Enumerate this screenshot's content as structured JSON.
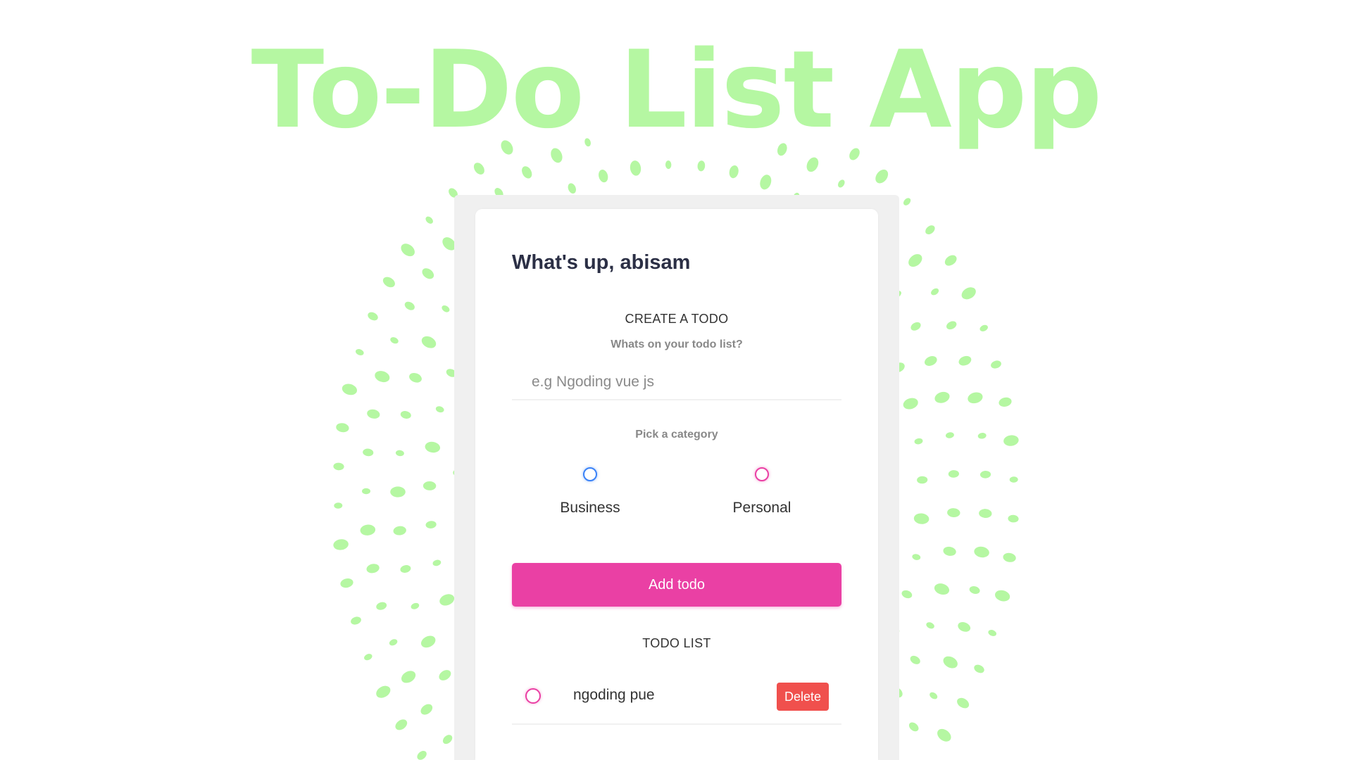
{
  "app": {
    "title": "To-Do List App",
    "accent_color": "#ea40a4",
    "title_color": "#b5f7a2",
    "dot_color": "#b5f7a2"
  },
  "greeting": "What's up, abisam",
  "create": {
    "title": "CREATE A TODO",
    "input_label": "Whats on your todo list?",
    "input_placeholder": "e.g Ngoding vue js",
    "input_value": "",
    "category_label": "Pick a category",
    "categories": [
      {
        "label": "Business",
        "color": "#3a82f7",
        "selected": false
      },
      {
        "label": "Personal",
        "color": "#ea40a4",
        "selected": false
      }
    ],
    "add_label": "Add todo"
  },
  "list": {
    "title": "TODO LIST",
    "items": [
      {
        "text": "ngoding pue",
        "category": "Personal",
        "done": false,
        "delete_label": "Delete"
      }
    ]
  }
}
